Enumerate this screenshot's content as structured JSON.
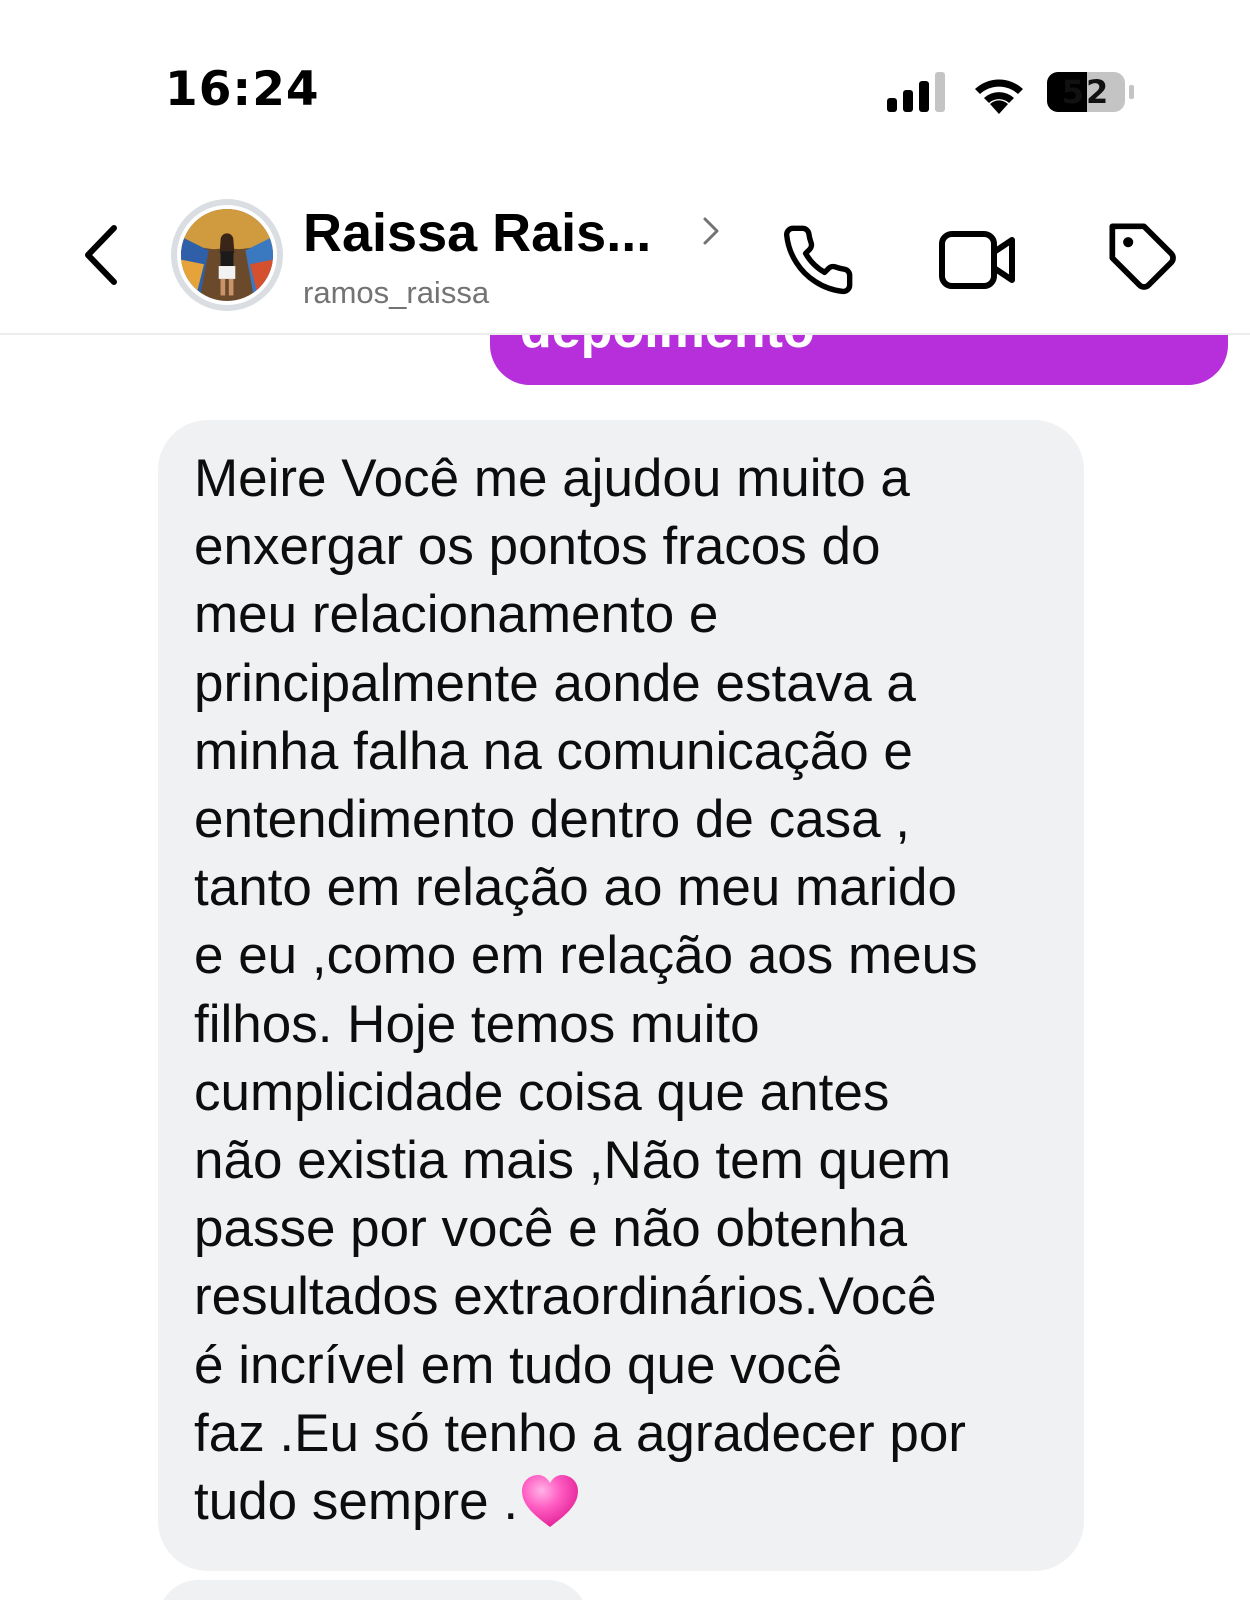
{
  "status_bar": {
    "time": "16:24",
    "battery": "52",
    "icons": [
      "cellular-signal-icon",
      "wifi-icon",
      "battery-icon"
    ]
  },
  "header": {
    "contact_name": "Raissa Rais...",
    "username": "ramos_raissa",
    "icons": [
      "back-chevron-icon",
      "chevron-right-icon",
      "phone-icon",
      "video-camera-icon",
      "tag-icon"
    ]
  },
  "messages": {
    "sent_partial_text": "depoimento",
    "received_text": "Meire Você me ajudou muito a\nenxergar os pontos fracos do\nmeu relacionamento e\nprincipalmente aonde estava a\nminha falha na comunicação e\nentendimento dentro de casa ,\ntanto em relação ao meu marido\ne eu ,como em relação aos meus\nfilhos. Hoje temos muito\ncumplicidade coisa que antes\nnão existia mais ,Não tem quem\npasse por você e não obtenha\nresultados extraordinários.Você\né incrível em tudo que você\nfaz .Eu só tenho a agradecer por\ntudo sempre .",
    "emoji": "pink-heart-icon"
  },
  "colors": {
    "sent_bubble": "#b62fdb",
    "received_bubble": "#eff1f3",
    "heart": "#ff4fb8"
  }
}
